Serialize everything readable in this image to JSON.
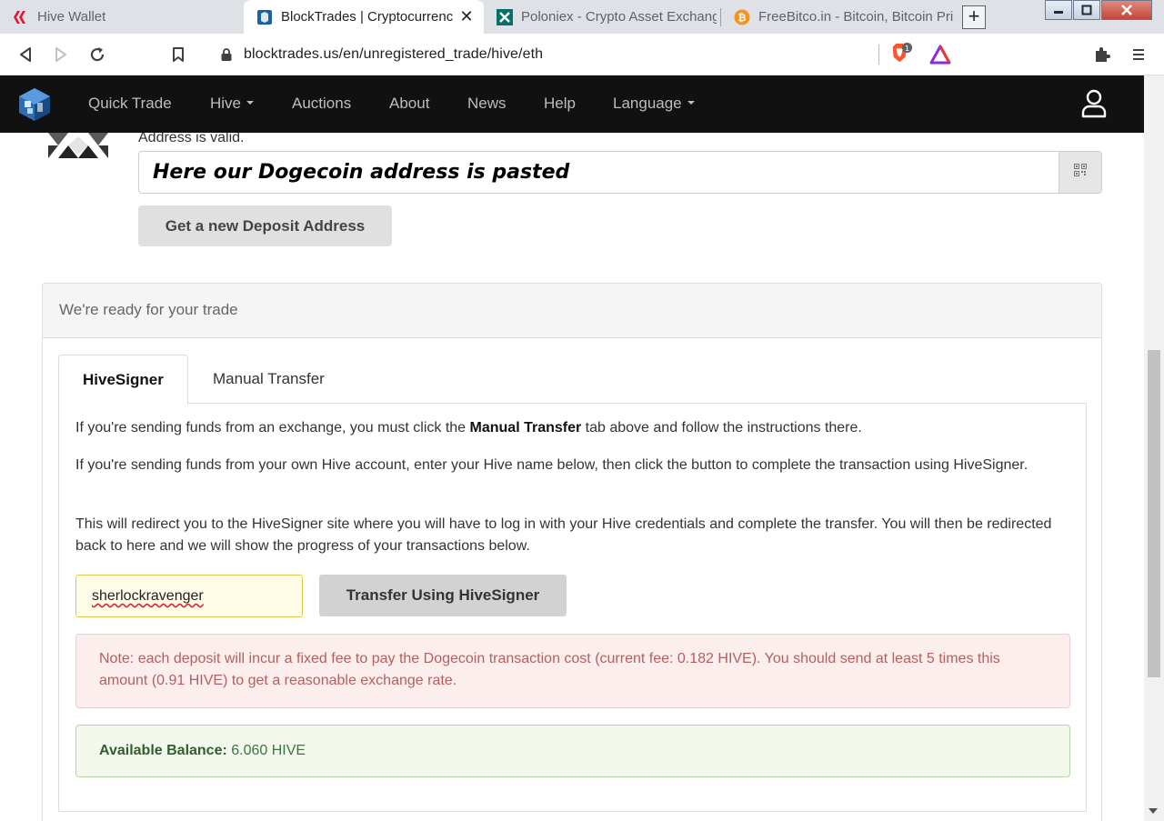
{
  "browser": {
    "tabs": [
      {
        "title": "Hive Wallet",
        "icon": "hive-icon"
      },
      {
        "title": "BlockTrades | Cryptocurrenc",
        "icon": "blocktrades-icon"
      },
      {
        "title": "Poloniex - Crypto Asset Exchang",
        "icon": "poloniex-icon"
      },
      {
        "title": "FreeBitco.in - Bitcoin, Bitcoin Pric",
        "icon": "bitcoin-icon"
      }
    ],
    "close_tab_glyph": "✕",
    "new_tab_glyph": "+",
    "url": "blocktrades.us/en/unregistered_trade/hive/eth",
    "brave_badge_count": "1"
  },
  "navbar": {
    "items": [
      {
        "label": "Quick Trade"
      },
      {
        "label": "Hive",
        "dropdown": true
      },
      {
        "label": "Auctions"
      },
      {
        "label": "About"
      },
      {
        "label": "News"
      },
      {
        "label": "Help"
      },
      {
        "label": "Language",
        "dropdown": true
      }
    ]
  },
  "address": {
    "status": "Address is valid.",
    "value": "Here our Dogecoin address is pasted",
    "new_deposit_label": "Get a new Deposit Address"
  },
  "trade_panel": {
    "heading": "We're ready for your trade",
    "tabs": [
      {
        "label": "HiveSigner",
        "active": true
      },
      {
        "label": "Manual Transfer",
        "active": false
      }
    ],
    "para1_before": "If you're sending funds from an exchange, you must click the ",
    "para1_bold": "Manual Transfer",
    "para1_after": " tab above and follow the instructions there.",
    "para2": "If you're sending funds from your own Hive account, enter your Hive name below, then click the button to complete the transaction using HiveSigner.",
    "para3": "This will redirect you to the HiveSigner site where you will have to log in with your Hive credentials and complete the transfer. You will then be redirected back to here and we will show the progress of your transactions below.",
    "hive_name_value": "sherlockravenger",
    "transfer_button": "Transfer Using HiveSigner",
    "fee_note": "Note: each deposit will incur a fixed fee to pay the Dogecoin transaction cost (current fee: 0.182 HIVE). You should send at least 5 times this amount (0.91 HIVE) to get a reasonable exchange rate.",
    "balance_label": "Available Balance:",
    "balance_value": "6.060 HIVE"
  },
  "colors": {
    "navbar_bg": "#111111",
    "danger_bg": "#fdeeee",
    "success_bg": "#f2f9ec",
    "input_highlight": "#fffde8"
  }
}
